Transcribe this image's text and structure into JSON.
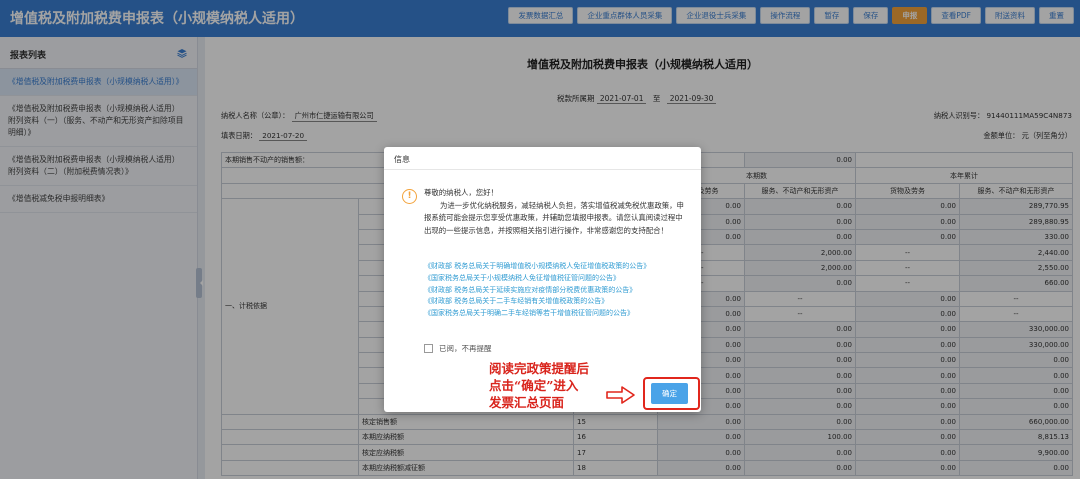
{
  "header": {
    "title": "增值税及附加税费申报表（小规模纳税人适用）",
    "buttons": [
      "发票数据汇总",
      "企业重点群体人员采集",
      "企业退役士兵采集",
      "操作流程",
      "暂存",
      "保存",
      "申报",
      "查看PDF",
      "附送资料",
      "重置"
    ],
    "primary_index": 6,
    "accent_color": "#3a7fd3",
    "primary_color": "#f3a33c"
  },
  "sidebar": {
    "title": "报表列表",
    "icon": "layers-icon",
    "items": [
      "《增值税及附加税费申报表（小规模纳税人适用）》",
      "《增值税及附加税费申报表（小规模纳税人适用）附列资料（一）（服务、不动产和无形资产扣除项目明细）》",
      "《增值税及附加税费申报表（小规模纳税人适用）附列资料（二）（附加税费情况表）》",
      "《增值税减免税申报明细表》"
    ],
    "active_index": 0
  },
  "document": {
    "title": "增值税及附加税费申报表（小规模纳税人适用）",
    "period_label": "税款所属期",
    "period_start": "2021-07-01",
    "period_sep": "至",
    "period_end": "2021-09-30",
    "taxpayer_name_label": "纳税人名称（公章）：",
    "taxpayer_name": "广州市仁捷运输有限公司",
    "taxpayer_id_label": "纳税人识别号：",
    "taxpayer_id": "91440111MA59C4N873",
    "fill_date_label": "填表日期：",
    "fill_date": "2021-07-20",
    "unit_label": "金额单位：",
    "unit": "元（列至角分）",
    "table": {
      "first_row_label": "本期销售不动产的销售额：",
      "first_row_value": "0.00",
      "group_current": "本期数",
      "group_year": "本年累计",
      "col_goods": "货物及劳务",
      "col_services": "服务、不动产和无形资产",
      "section_label": "一、计税依据",
      "rows": [
        [
          "0.00",
          "0.00",
          "0.00",
          "289,770.95"
        ],
        [
          "0.00",
          "0.00",
          "0.00",
          "289,880.95"
        ],
        [
          "0.00",
          "0.00",
          "0.00",
          "330.00"
        ],
        [
          "--",
          "2,000.00",
          "--",
          "2,440.00"
        ],
        [
          "--",
          "2,000.00",
          "--",
          "2,550.00"
        ],
        [
          "--",
          "0.00",
          "--",
          "660.00"
        ],
        [
          "0.00",
          "--",
          "0.00",
          "--"
        ],
        [
          "0.00",
          "--",
          "0.00",
          "--"
        ],
        [
          "0.00",
          "0.00",
          "0.00",
          "330,000.00"
        ],
        [
          "0.00",
          "0.00",
          "0.00",
          "330,000.00"
        ],
        [
          "0.00",
          "0.00",
          "0.00",
          "0.00"
        ],
        [
          "0.00",
          "0.00",
          "0.00",
          "0.00"
        ],
        [
          "0.00",
          "0.00",
          "0.00",
          "0.00"
        ],
        [
          "0.00",
          "0.00",
          "0.00",
          "0.00"
        ]
      ],
      "lower_rows": [
        {
          "label": "核定销售额",
          "line": "15",
          "values": [
            "0.00",
            "0.00",
            "0.00",
            "660,000.00"
          ]
        },
        {
          "label": "本期应纳税额",
          "line": "16",
          "values": [
            "0.00",
            "100.00",
            "0.00",
            "8,815.13"
          ]
        },
        {
          "label": "核定应纳税额",
          "line": "17",
          "values": [
            "0.00",
            "0.00",
            "0.00",
            "9,900.00"
          ]
        },
        {
          "label": "本期应纳税额减征额",
          "line": "18",
          "values": [
            "0.00",
            "0.00",
            "0.00",
            "0.00"
          ]
        }
      ]
    }
  },
  "dialog": {
    "title": "信息",
    "icon": "warning-icon",
    "greeting": "尊敬的纳税人，您好！",
    "paragraph": "为进一步优化纳税服务，减轻纳税人负担，落实增值税减免税优惠政策，申报系统可能会提示您享受优惠政策，并辅助您填报申报表。请您认真阅读过程中出现的一些提示信息，并按照相关指引进行操作，非常感谢您的支持配合！",
    "links": [
      "《财政部 税务总局关于明确增值税小规模纳税人免征增值税政策的公告》",
      "《国家税务总局关于小规模纳税人免征增值税征管问题的公告》",
      "《财政部 税务总局关于延续实施应对疫情部分税费优惠政策的公告》",
      "《财政部 税务总局关于二手车经销有关增值税政策的公告》",
      "《国家税务总局关于明确二手车经销等若干增值税征管问题的公告》"
    ],
    "checkbox_label": "已阅，不再提醒",
    "confirm_label": "确定"
  },
  "annotation": {
    "text": [
      "阅读完政策提醒后",
      "点击“确定”进入",
      "发票汇总页面"
    ],
    "color": "#d9241c"
  }
}
